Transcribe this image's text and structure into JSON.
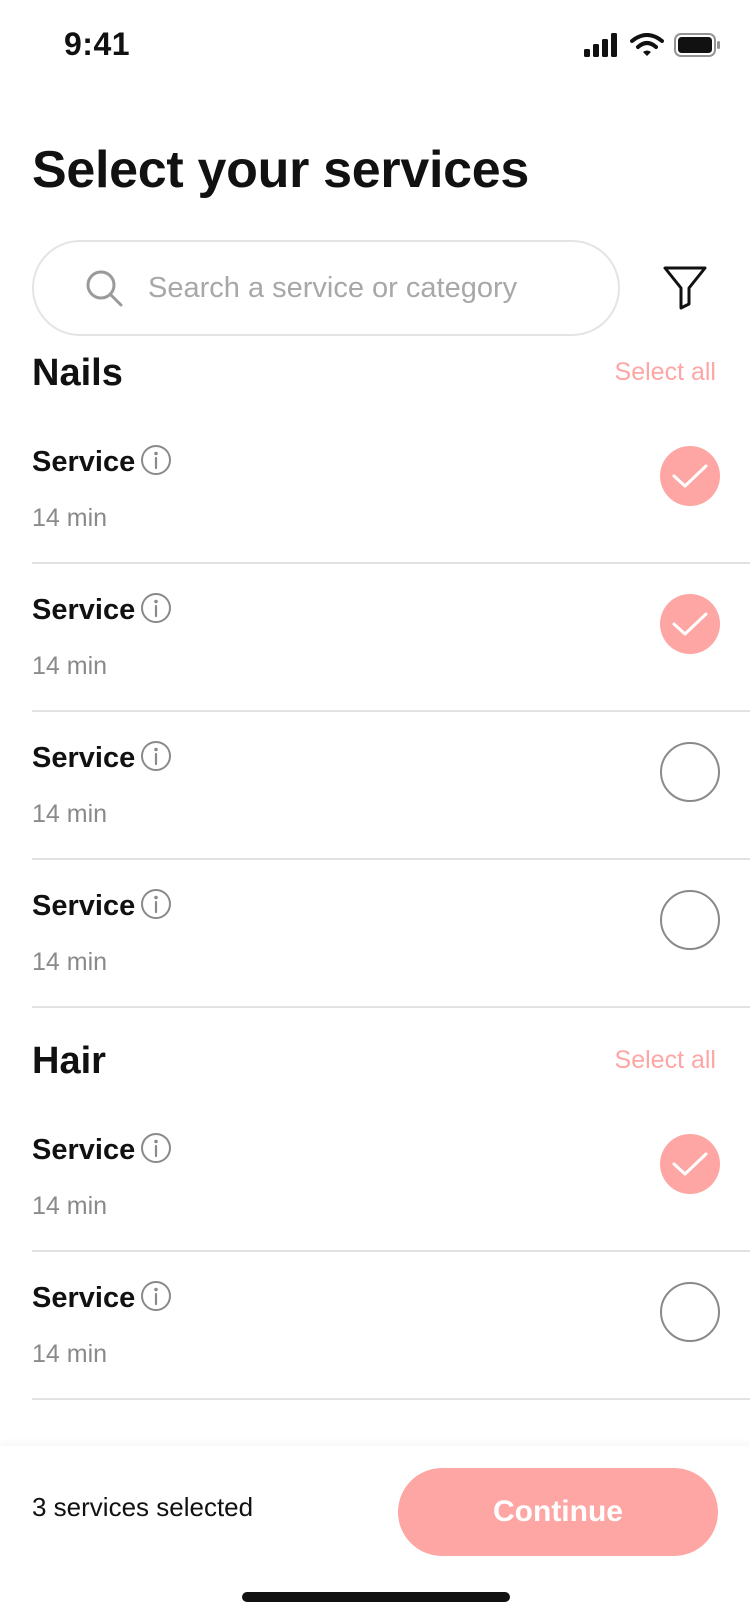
{
  "status_bar": {
    "time": "9:41"
  },
  "header": {
    "title": "Select your services"
  },
  "search": {
    "placeholder": "Search a service or category"
  },
  "icons": {
    "search": "search-icon",
    "filter": "filter-icon",
    "info": "info-icon",
    "check": "check-icon",
    "signal": "signal-icon",
    "wifi": "wifi-icon",
    "battery": "battery-icon"
  },
  "colors": {
    "accent": "#fda6a4",
    "divider": "#e2e2e2",
    "muted": "#8a8a8a"
  },
  "sections": [
    {
      "title": "Nails",
      "select_all_label": "Select all",
      "services": [
        {
          "name": "Service",
          "duration": "14 min",
          "selected": true
        },
        {
          "name": "Service",
          "duration": "14 min",
          "selected": true
        },
        {
          "name": "Service",
          "duration": "14 min",
          "selected": false
        },
        {
          "name": "Service",
          "duration": "14 min",
          "selected": false
        }
      ]
    },
    {
      "title": "Hair",
      "select_all_label": "Select all",
      "services": [
        {
          "name": "Service",
          "duration": "14 min",
          "selected": true
        },
        {
          "name": "Service",
          "duration": "14 min",
          "selected": false
        }
      ]
    }
  ],
  "footer": {
    "selected_text": "3 services selected",
    "continue_label": "Continue"
  }
}
